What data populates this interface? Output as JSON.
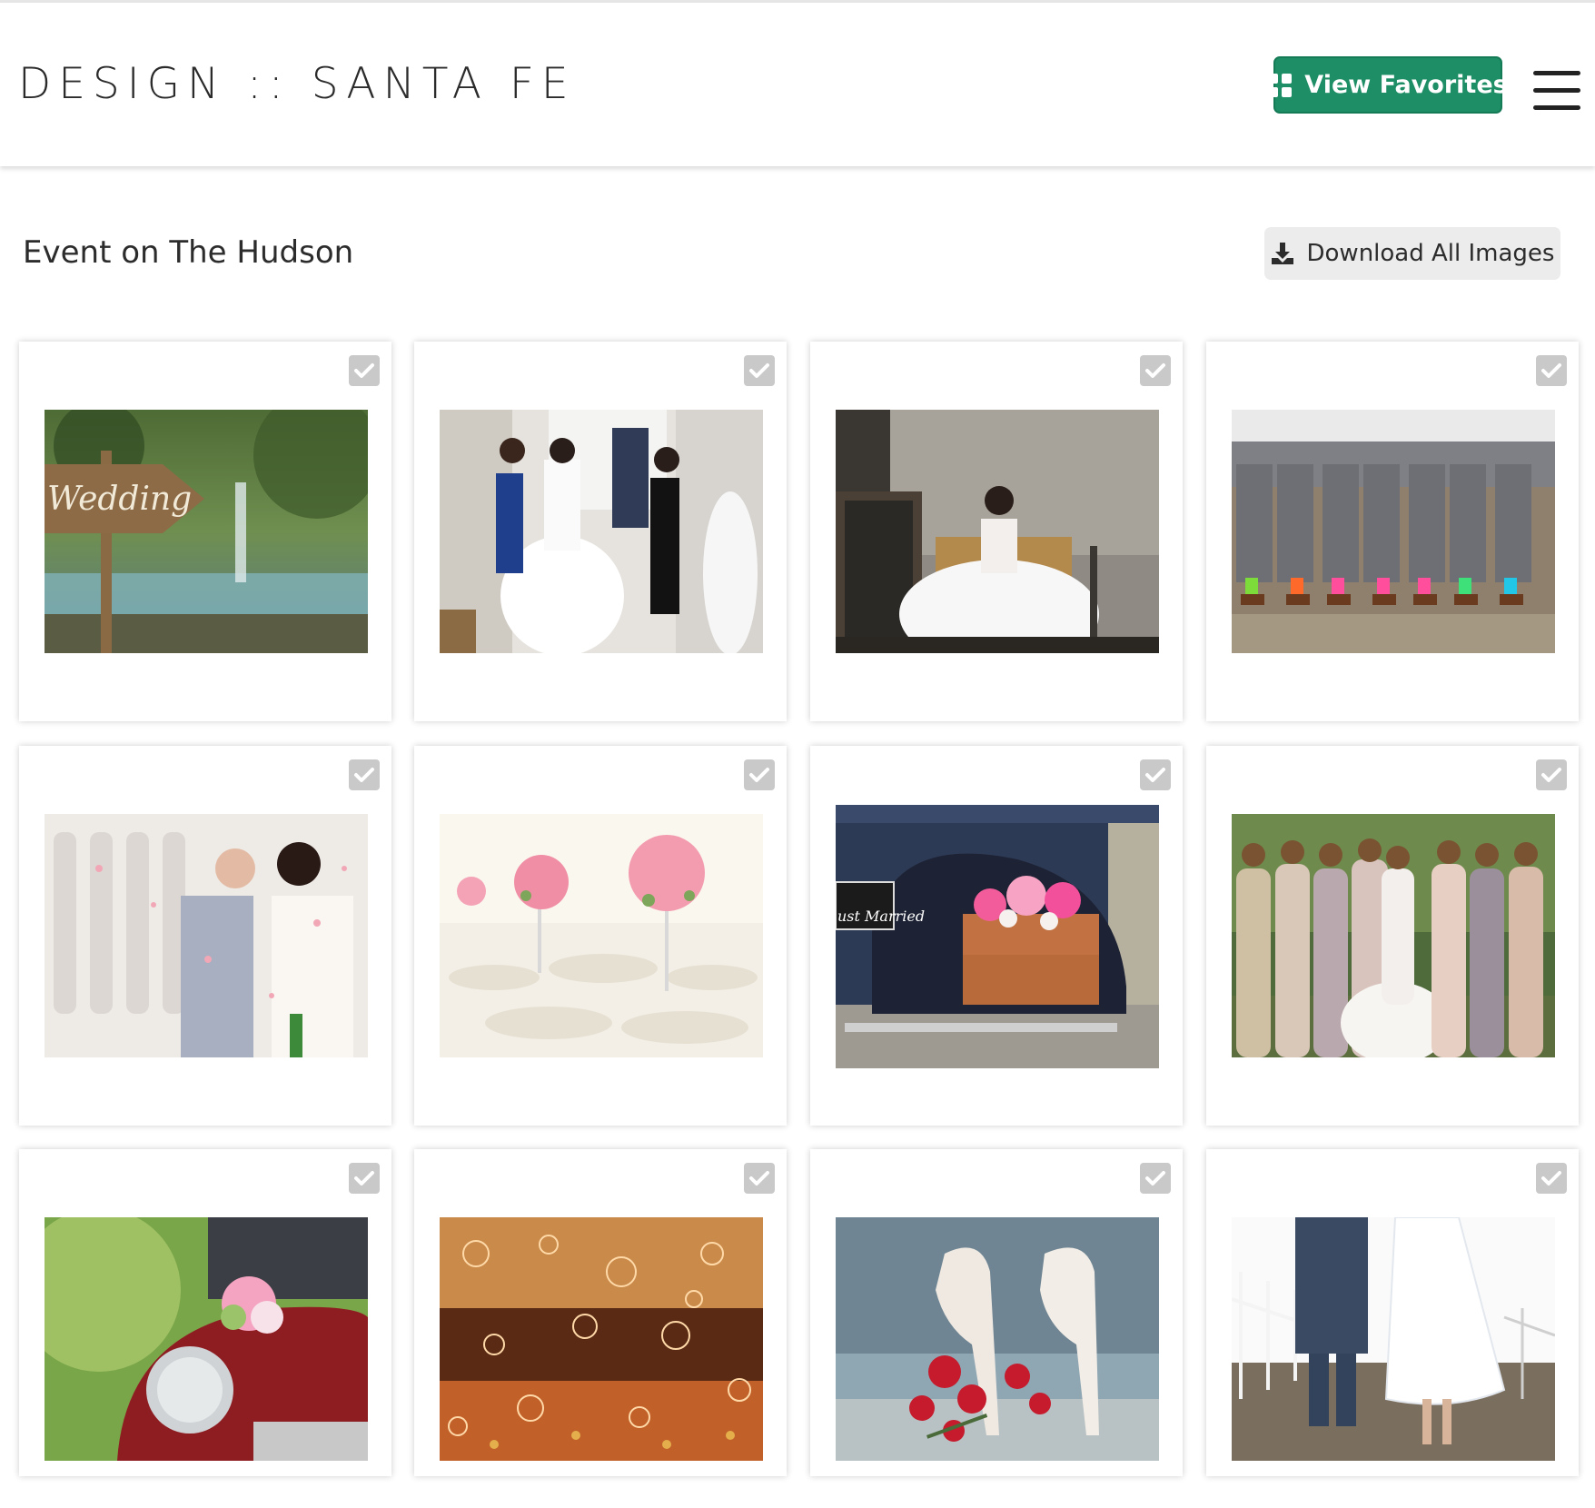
{
  "header": {
    "brand": "DESIGN :: SANTA FE",
    "favorites_button": "View Favorites",
    "favorites_icon": "grid-icon",
    "menu_icon": "hamburger-menu-icon",
    "accent_color": "#1e8e66"
  },
  "gallery": {
    "title": "Event on The Hudson",
    "download_button": "Download All Images",
    "download_icon": "download-icon",
    "select_icon": "checkmark-icon",
    "photos": [
      {
        "subject": "wedding-sign",
        "sign_text": "Wedding"
      },
      {
        "subject": "bridal-fitting"
      },
      {
        "subject": "bride-in-chair"
      },
      {
        "subject": "groomsmen-socks"
      },
      {
        "subject": "couple-confetti"
      },
      {
        "subject": "reception-tables"
      },
      {
        "subject": "just-married-car",
        "sign_text": "ust Married"
      },
      {
        "subject": "bridesmaids"
      },
      {
        "subject": "red-car-bouquet"
      },
      {
        "subject": "bubbles-reception"
      },
      {
        "subject": "bridal-shoes"
      },
      {
        "subject": "couple-walking"
      }
    ]
  }
}
